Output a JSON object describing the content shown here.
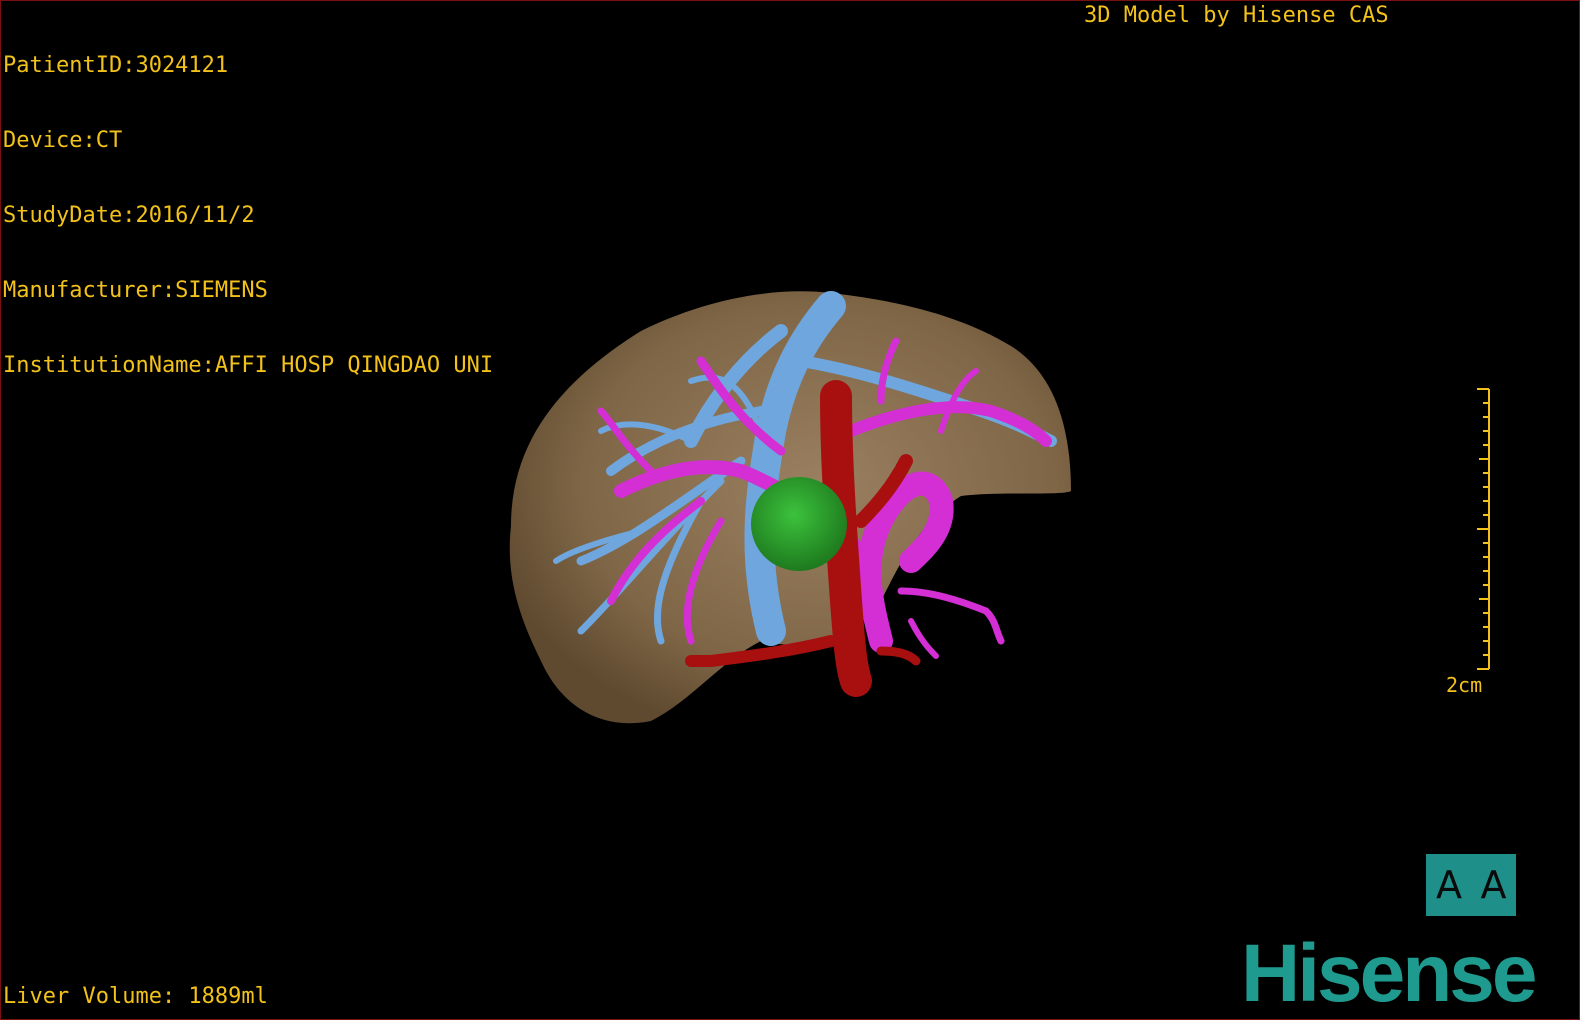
{
  "study": {
    "patient_id": "PatientID:3024121",
    "device": "Device:CT",
    "study_date": "StudyDate:2016/11/2",
    "manufacturer": "Manufacturer:SIEMENS",
    "institution": "InstitutionName:AFFI HOSP QINGDAO UNI"
  },
  "credit": "3D Model by Hisense CAS",
  "measurements": {
    "liver_volume": "Liver Volume: 1889ml"
  },
  "scale": {
    "label": "2cm"
  },
  "orientation": {
    "left_glyph": "A",
    "right_glyph": "A"
  },
  "brand": {
    "name": "Hisense"
  },
  "colors": {
    "overlay_text": "#f2c21a",
    "liver": "#8a6f4e",
    "hepatic_vein": "#6fa6dd",
    "portal_vein": "#d42fd4",
    "artery": "#a81010",
    "lesion": "#2e9e2e",
    "brand": "#1f9a8f",
    "border": "#7a1010"
  }
}
